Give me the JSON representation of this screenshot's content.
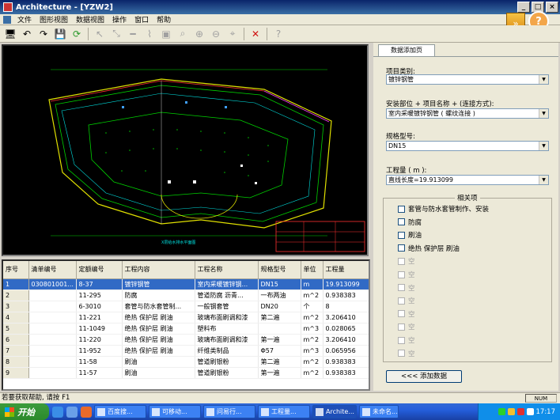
{
  "window": {
    "title": "Architecture - [YZW2]"
  },
  "menu": [
    "文件",
    "图形视图",
    "数据视图",
    "操作",
    "窗口",
    "帮助"
  ],
  "cad": {
    "drawing_title": "X层给水排水平面图"
  },
  "table": {
    "columns": [
      "序号",
      "清单编号",
      "定额编号",
      "工程内容",
      "工程名称",
      "规格型号",
      "单位",
      "工程量"
    ],
    "rows": [
      [
        "1",
        "030801001...",
        "8-37",
        "镀锌钢管",
        "室内采暖镀锌钢...",
        "DN15",
        "m",
        "19.913099"
      ],
      [
        "2",
        "",
        "11-295",
        "防腐",
        "管道防腐 沥青...",
        "一布两油",
        "m^2",
        "0.938383"
      ],
      [
        "3",
        "",
        "6-3010",
        "套管与防水套管制...",
        "一般钢套管",
        "DN20",
        "个",
        "8"
      ],
      [
        "4",
        "",
        "11-221",
        "绝热 保护层 刷油",
        "玻璃布面刷调和漆",
        "第二遍",
        "m^2",
        "3.206410"
      ],
      [
        "5",
        "",
        "11-1049",
        "绝热 保护层 刷油",
        "塑料布",
        "",
        "m^3",
        "0.028065"
      ],
      [
        "6",
        "",
        "11-220",
        "绝热 保护层 刷油",
        "玻璃布面刷调和漆",
        "第一遍",
        "m^2",
        "3.206410"
      ],
      [
        "7",
        "",
        "11-952",
        "绝热 保护层 刷油",
        "纤维类制品",
        "Φ57",
        "m^3",
        "0.065956"
      ],
      [
        "8",
        "",
        "11-58",
        "刷油",
        "管道刷银粉",
        "第二遍",
        "m^2",
        "0.938383"
      ],
      [
        "9",
        "",
        "11-57",
        "刷油",
        "管道刷银粉",
        "第一遍",
        "m^2",
        "0.938383"
      ]
    ]
  },
  "panel": {
    "tab": "数据添加页",
    "item_type_label": "项目类别:",
    "item_type_value": "镀锌钢管",
    "location_label": "安装部位 + 项目名称 + (连接方式):",
    "location_value": "室内采暖镀锌钢管 ( 螺纹连接 )",
    "spec_label": "规格型号:",
    "spec_value": "DN15",
    "quantity_label": "工程量 ( m ):",
    "quantity_value": "直线长度=19.913099",
    "related_title": "相关项",
    "related_items": [
      {
        "label": "套管与防水套管制作、安装",
        "enabled": true
      },
      {
        "label": "防腐",
        "enabled": true
      },
      {
        "label": "刷油",
        "enabled": true
      },
      {
        "label": "绝热 保护层 刷油",
        "enabled": true
      },
      {
        "label": "空",
        "enabled": false
      },
      {
        "label": "空",
        "enabled": false
      },
      {
        "label": "空",
        "enabled": false
      },
      {
        "label": "空",
        "enabled": false
      },
      {
        "label": "空",
        "enabled": false
      },
      {
        "label": "空",
        "enabled": false
      },
      {
        "label": "空",
        "enabled": false
      },
      {
        "label": "空",
        "enabled": false
      }
    ],
    "add_button": "<<<   添加数据"
  },
  "status": {
    "text": "若要获取帮助, 请按 F1",
    "num": "NUM"
  },
  "taskbar": {
    "start": "开始",
    "tasks": [
      "百度搜...",
      "可移动...",
      "问易行...",
      "工程量...",
      "Archite...",
      "未命名..."
    ],
    "clock": "17:17"
  },
  "colors": {
    "cad_bg": "#000000",
    "selection": "#316ac5",
    "taskbar": "#245edb"
  }
}
